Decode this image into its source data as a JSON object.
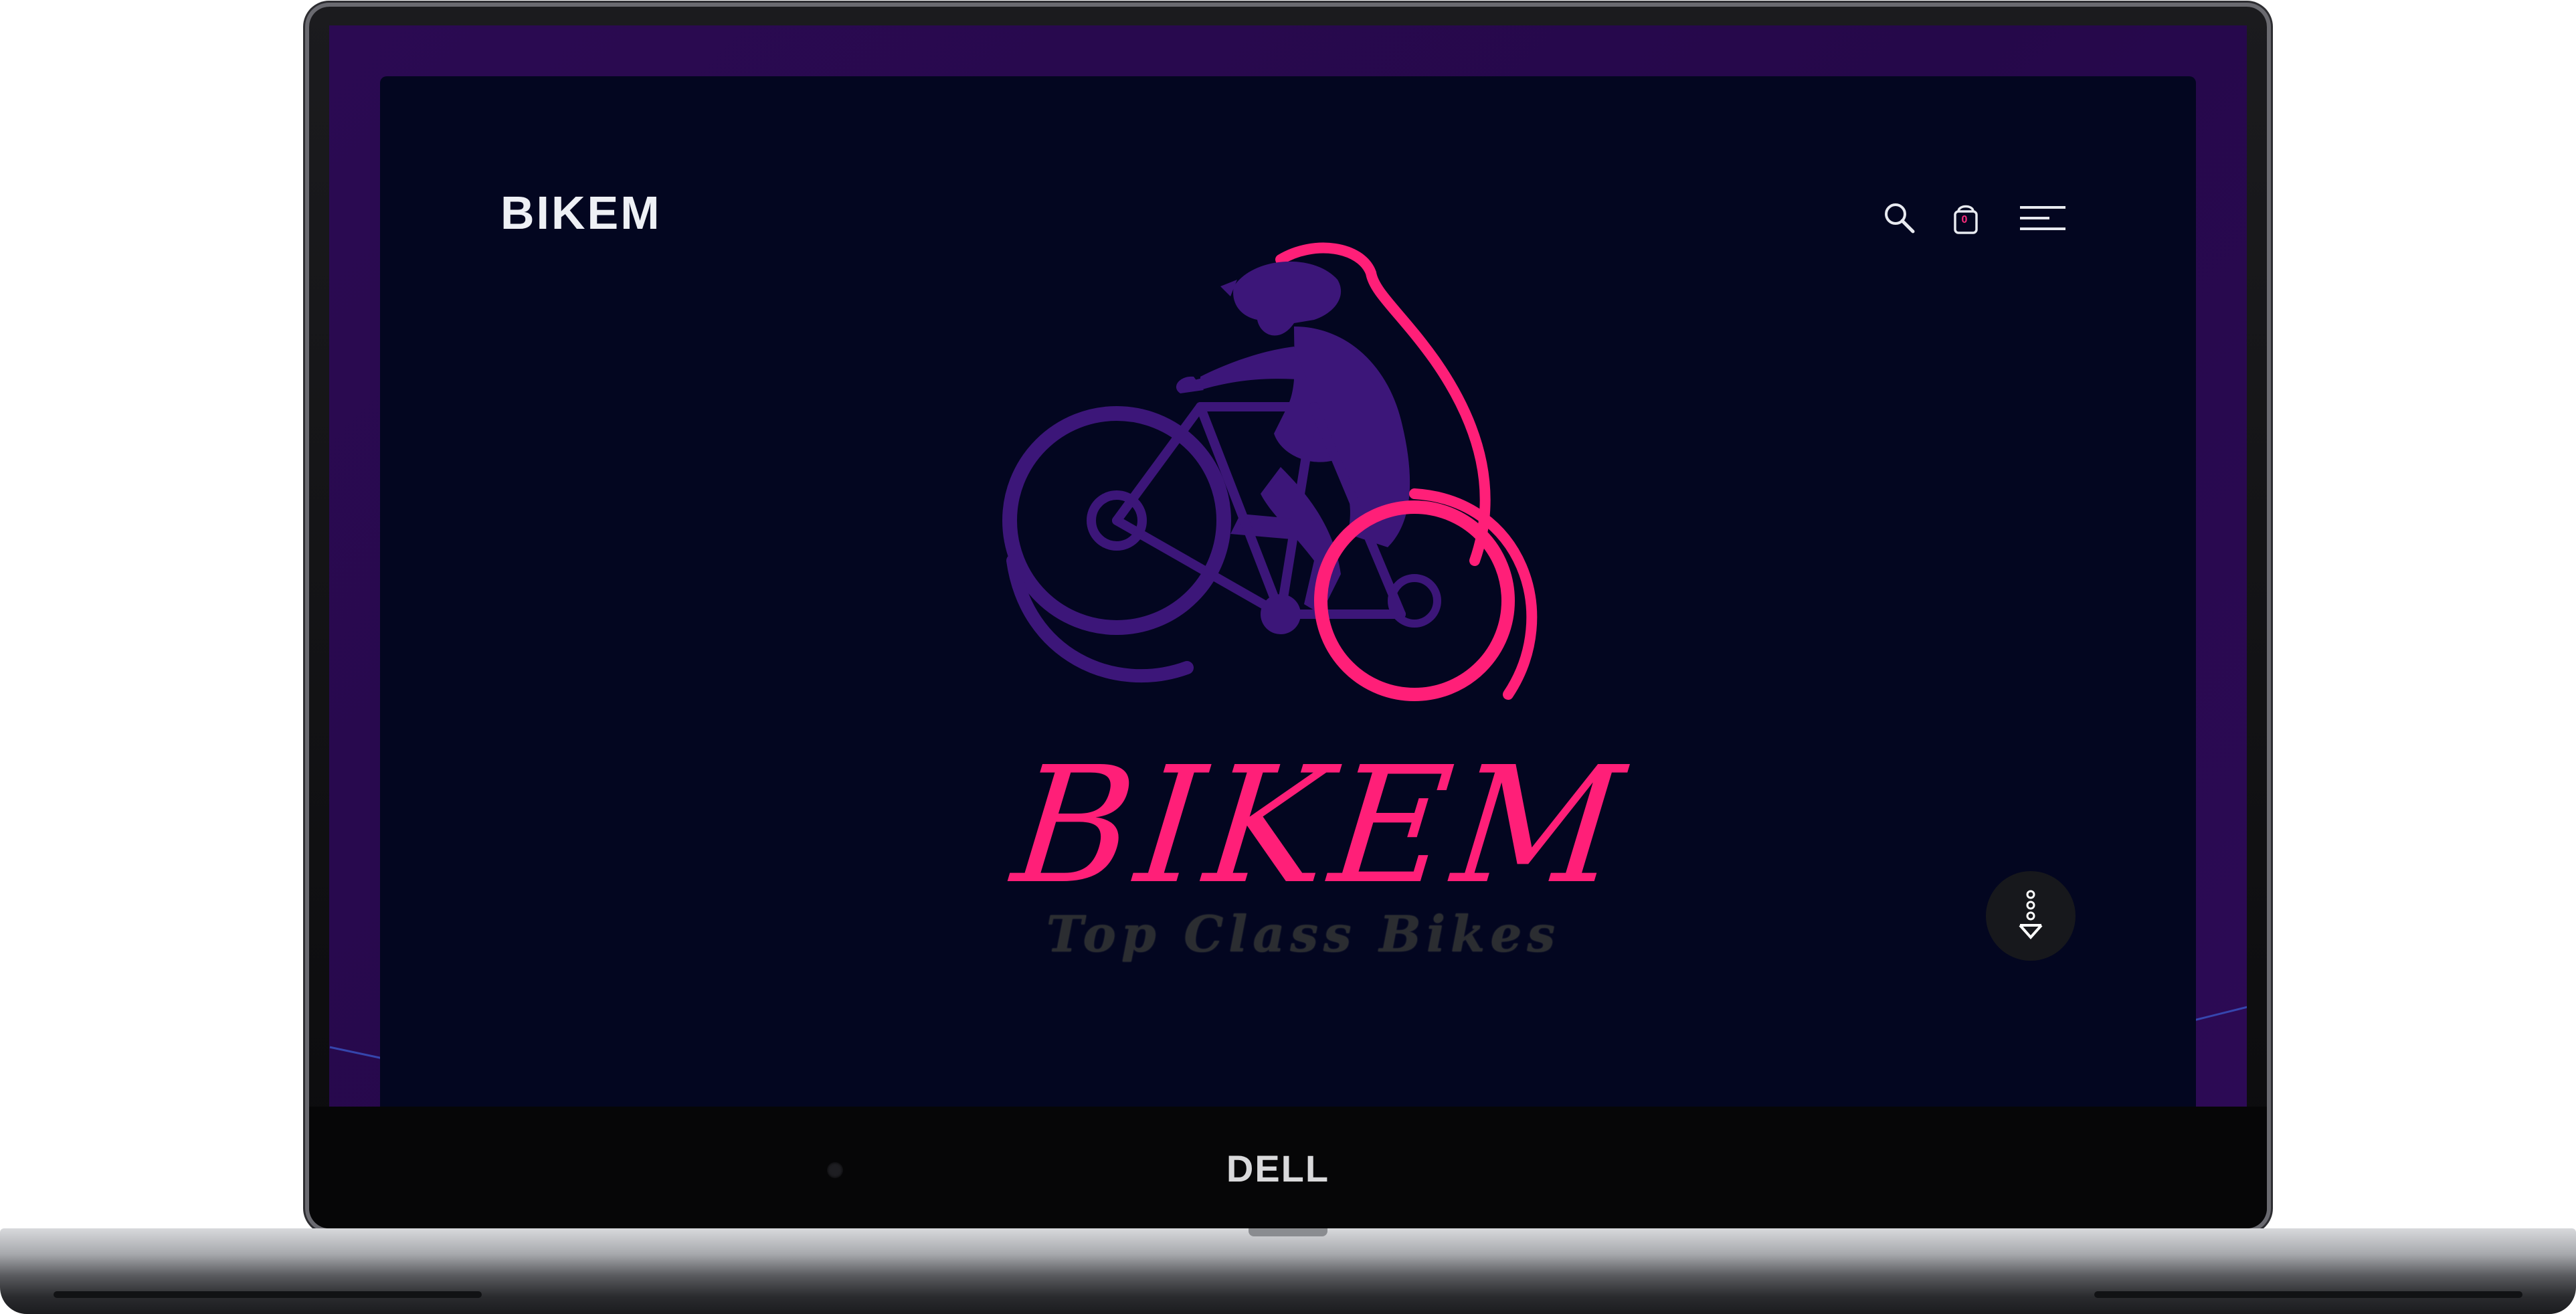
{
  "device": {
    "brand_logo": "DELL"
  },
  "site": {
    "logo_text": "BIKEM",
    "header": {
      "search_icon": "search-icon",
      "cart_icon": "shopping-bag-icon",
      "cart_count": "0",
      "menu_icon": "hamburger-menu-icon"
    },
    "hero": {
      "brand_title": "BIKEM",
      "tagline": "Top Class Bikes",
      "illustration": "cyclist-on-mountain-bike",
      "scroll_icon": "scroll-down-icon"
    }
  },
  "colors": {
    "background": "#030620",
    "frame_purple": "#2b0a52",
    "accent_pink": "#ff1f78",
    "accent_purple": "#3c1679",
    "tagline_grey": "#2b2d31"
  }
}
